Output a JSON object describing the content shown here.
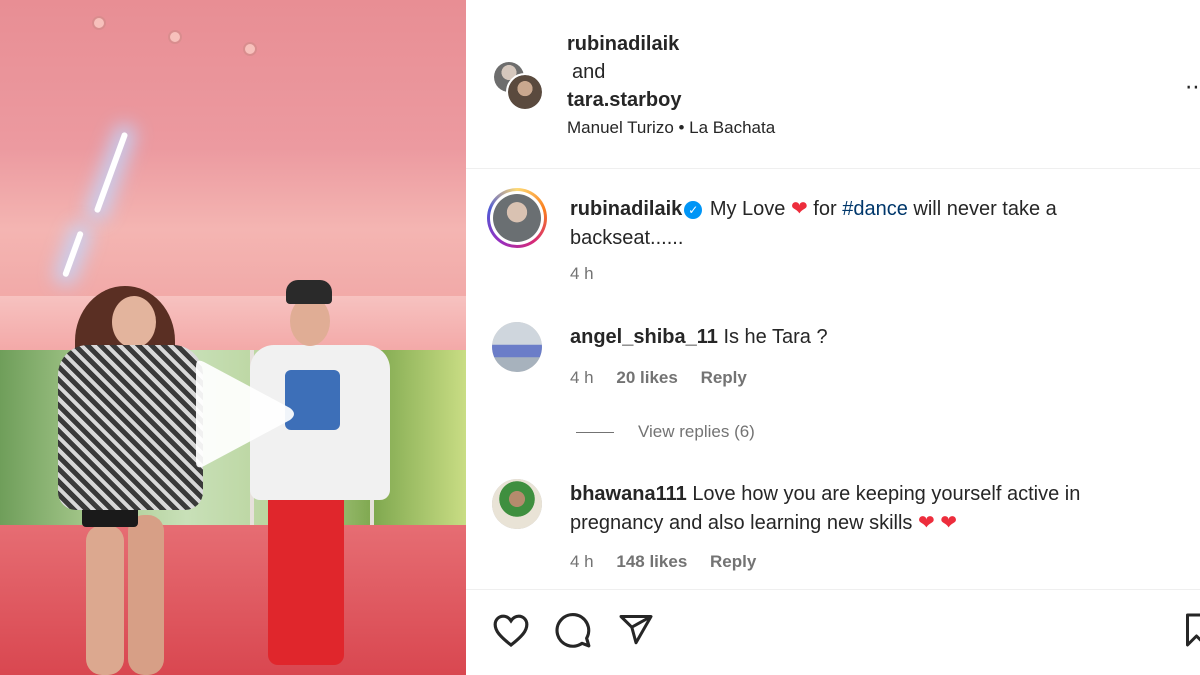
{
  "post": {
    "author_1": "rubinadilaik",
    "joiner": "and",
    "author_2": "tara.starboy",
    "audio": "Manuel Turizo • La Bachata"
  },
  "caption": {
    "username": "rubinadilaik",
    "text_1": "My Love",
    "heart": "❤",
    "text_2": "for",
    "hashtag": "#dance",
    "text_3": "will never take a backseat......",
    "time": "4 h"
  },
  "comments": [
    {
      "username": "angel_shiba_11",
      "text": "Is he Tara ?",
      "time": "4 h",
      "likes": "20 likes",
      "reply": "Reply",
      "view_replies": "View replies (6)"
    },
    {
      "username": "bhawana111",
      "text": "Love how you are keeping yourself active in pregnancy and also learning new skills",
      "hearts": "❤ ❤",
      "time": "4 h",
      "likes": "148 likes",
      "reply": "Reply"
    }
  ],
  "icons": {
    "more": "more-options-icon",
    "like": "heart-icon",
    "comment": "comment-icon",
    "share": "send-icon",
    "save": "bookmark-icon",
    "play": "play-icon"
  },
  "colors": {
    "link": "#00376b",
    "heart": "#ed2d3c",
    "verified": "#0095f6",
    "secondary_text": "#737373"
  }
}
